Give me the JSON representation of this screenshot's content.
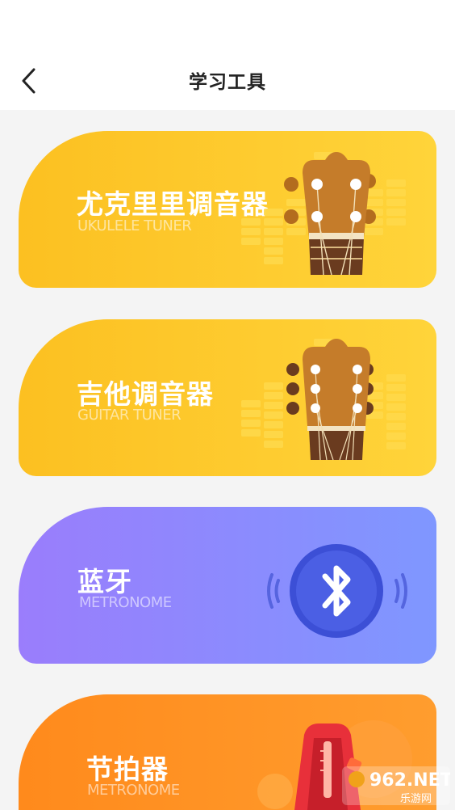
{
  "header": {
    "title": "学习工具"
  },
  "cards": [
    {
      "title": "尤克里里调音器",
      "subtitle": "UKULELE TUNER"
    },
    {
      "title": "吉他调音器",
      "subtitle": "GUITAR TUNER"
    },
    {
      "title": "蓝牙",
      "subtitle": "METRONOME"
    },
    {
      "title": "节拍器",
      "subtitle": "METRONOME"
    }
  ],
  "watermark": {
    "brand": "962.NET",
    "sub": "乐游网"
  },
  "colors": {
    "yellow": "#fcc021",
    "purple": "#9a7dfc",
    "blue": "#3f55d8",
    "orange": "#ff8a1c"
  }
}
